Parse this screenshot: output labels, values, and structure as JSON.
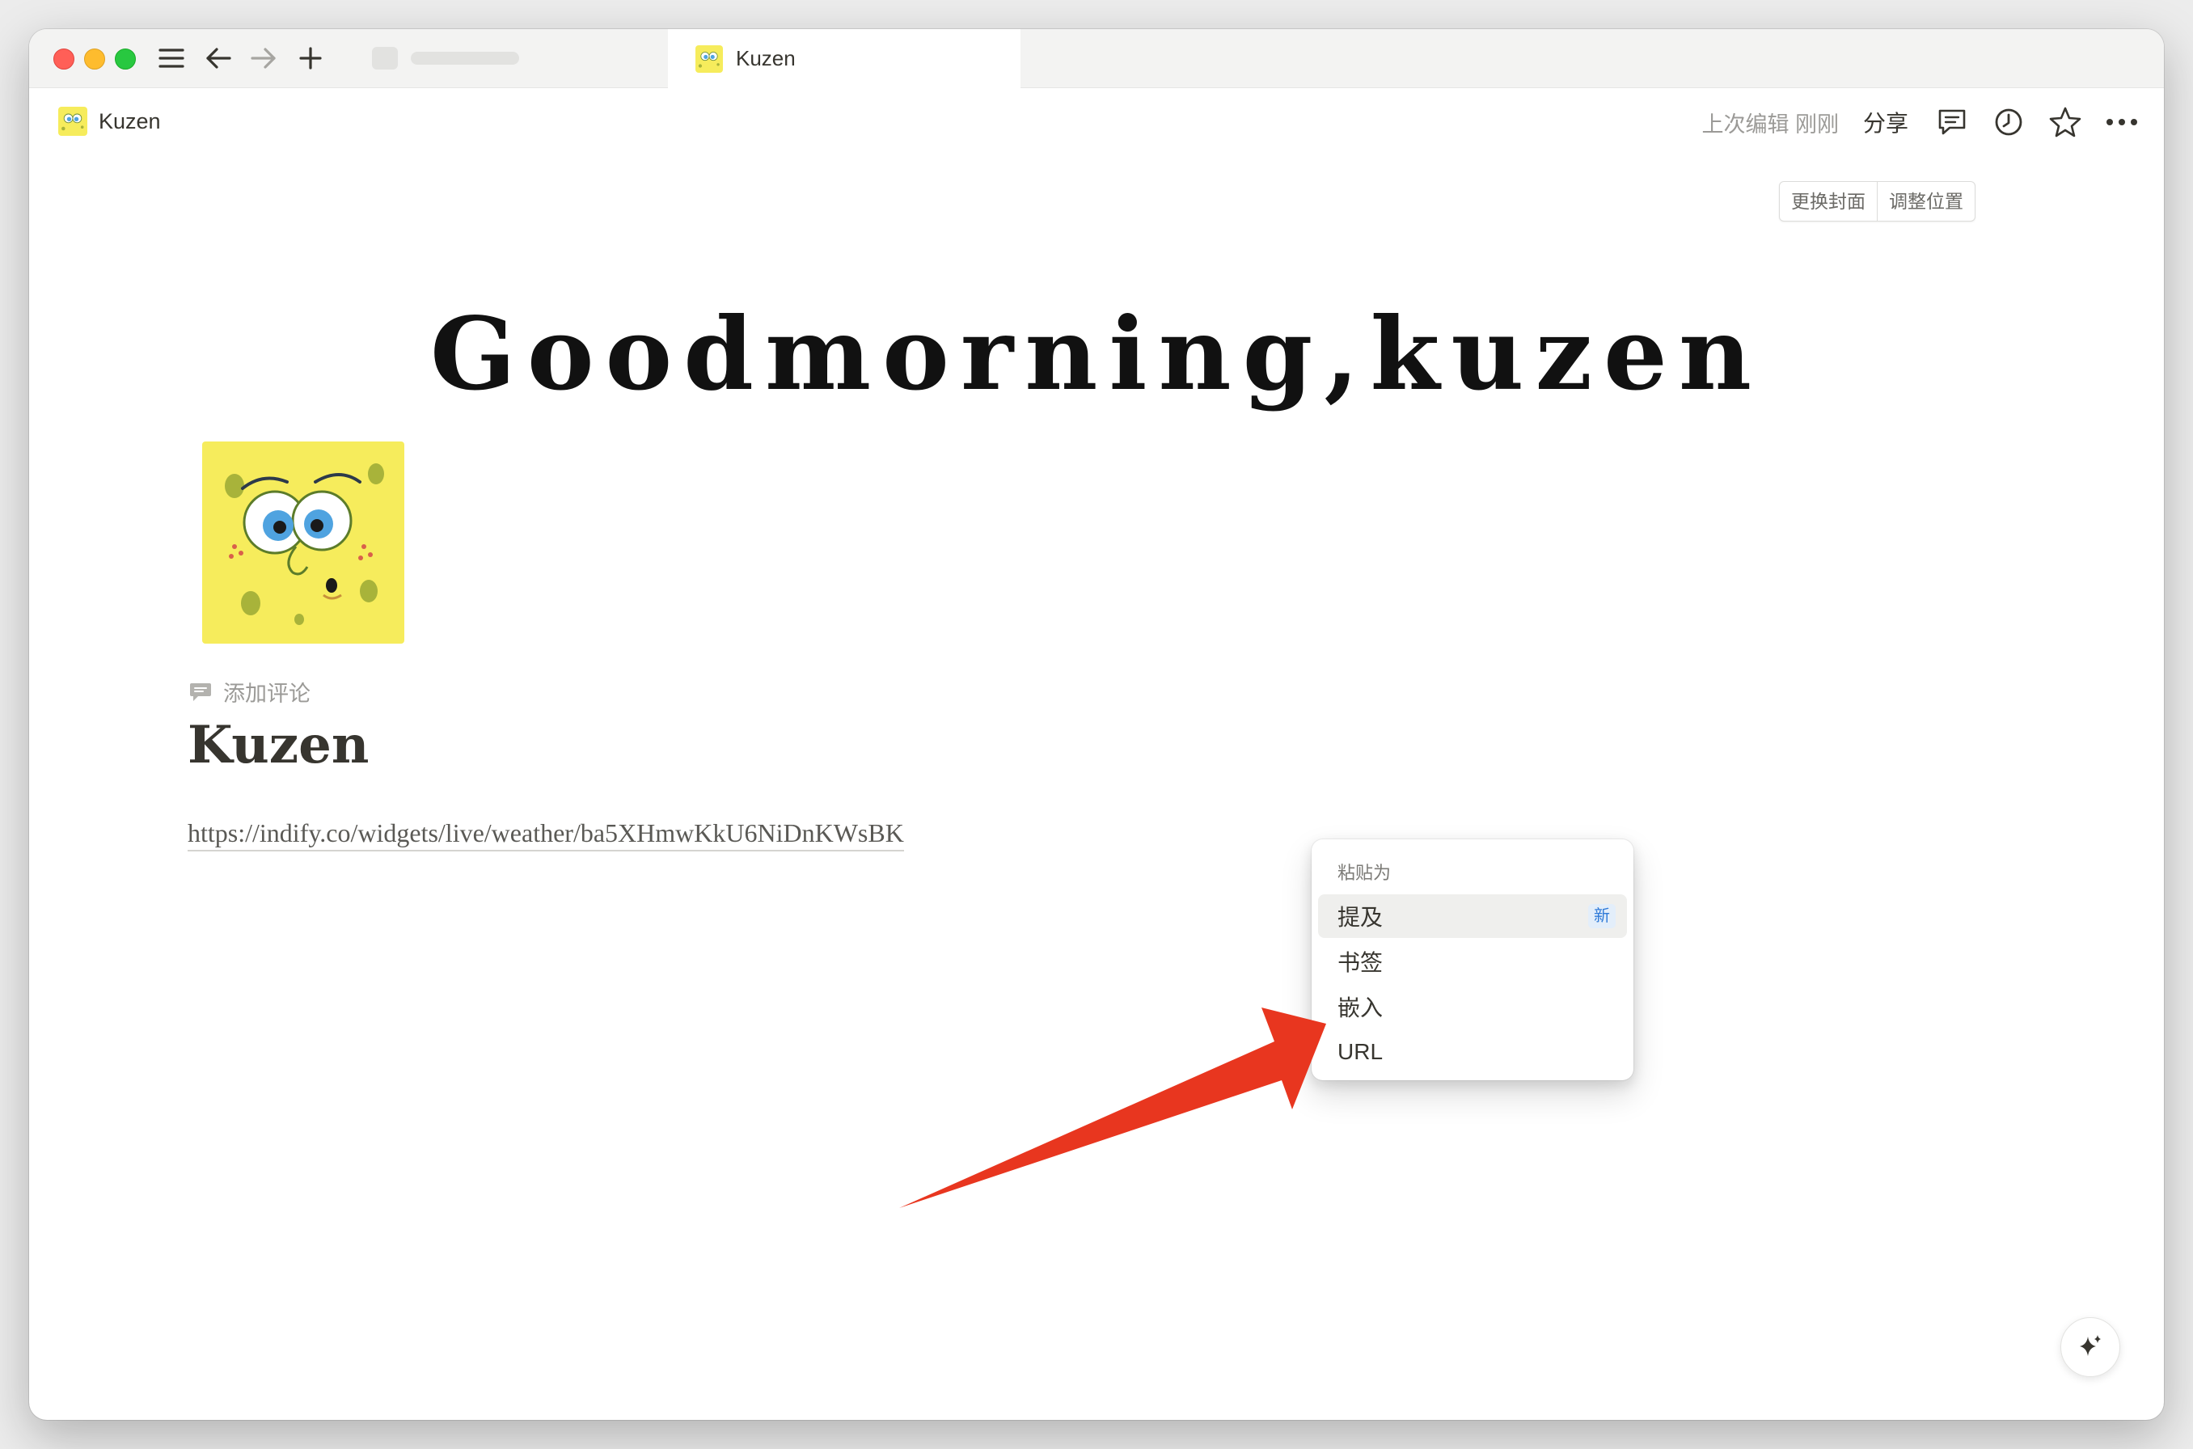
{
  "tab": {
    "title": "Kuzen"
  },
  "breadcrumb": {
    "title": "Kuzen"
  },
  "topbar": {
    "edited": "上次编辑 刚刚",
    "share": "分享"
  },
  "cover": {
    "change_cover": "更换封面",
    "reposition": "调整位置",
    "title": "Goodmorning,kuzen"
  },
  "page": {
    "add_comment": "添加评论",
    "title": "Kuzen",
    "url": "https://indify.co/widgets/live/weather/ba5XHmwKkU6NiDnKWsBK"
  },
  "paste_menu": {
    "heading": "粘贴为",
    "items": [
      {
        "label": "提及",
        "badge": "新"
      },
      {
        "label": "书签"
      },
      {
        "label": "嵌入"
      },
      {
        "label": "URL"
      }
    ]
  },
  "icons": {
    "sidebar_toggle": "hamburger-icon",
    "back": "arrow-left-icon",
    "forward": "arrow-right-icon",
    "new_tab": "plus-icon",
    "comments": "comment-icon",
    "history": "clock-icon",
    "favorite": "star-icon",
    "more": "more-dots-icon",
    "ai": "sparkle-icon"
  },
  "colors": {
    "annotation_arrow": "#e8361f",
    "page_icon_bg": "#f6ec5c",
    "badge_text": "#2f7ad8"
  }
}
